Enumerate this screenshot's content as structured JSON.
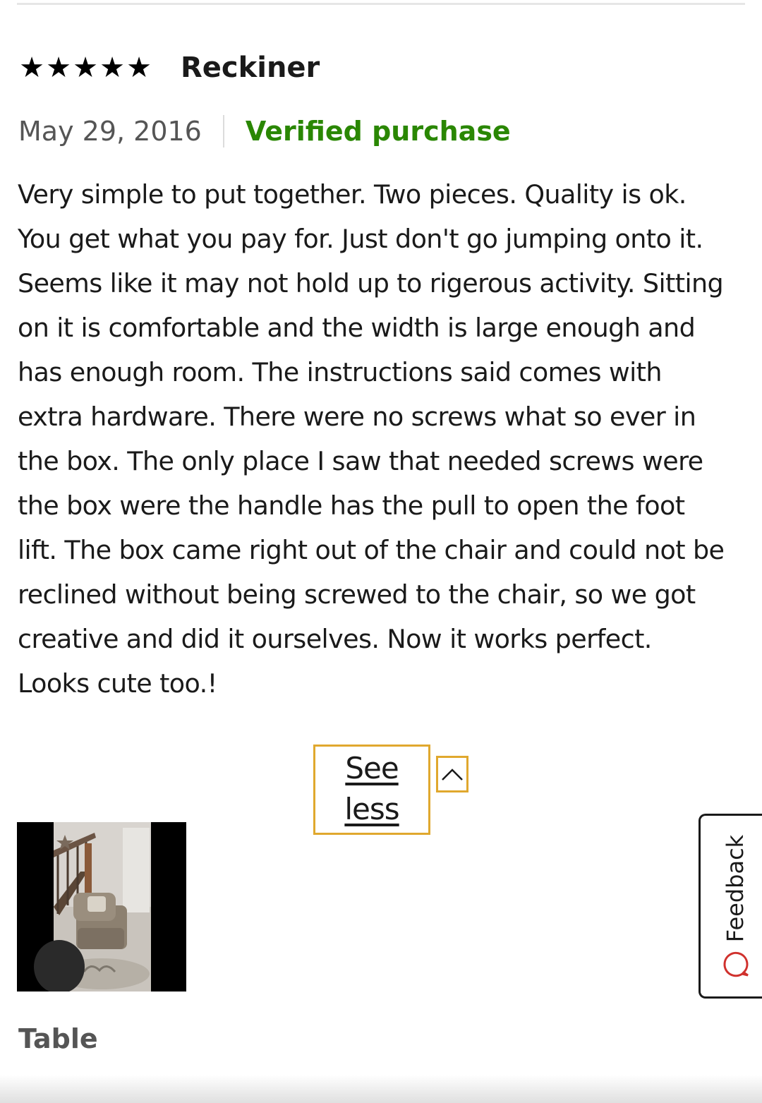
{
  "review": {
    "rating": 5,
    "rating_max": 5,
    "stars": [
      "★",
      "★",
      "★",
      "★",
      "★"
    ],
    "title": "Reckiner",
    "date": "May 29, 2016",
    "verified_label": "Verified purchase",
    "body": "Very simple to put together. Two pieces. Quality is ok. You get what you pay for. Just don't go jumping onto it. Seems like it may not hold up to rigerous activity. Sitting on it is comfortable and the width is large enough and has enough room. The instructions said comes with extra hardware. There were no screws what so ever in the box. The only place I saw that needed screws were the box were the handle has the pull to open the foot lift. The box came right out of the chair and could not be reclined without being screwed to the chair, so we got creative and did it ourselves. Now it works perfect. Looks cute too.!",
    "toggle_label": "See less",
    "photo_caption": "Table"
  },
  "feedback": {
    "label": "Feedback"
  },
  "colors": {
    "verified": "#2a8703",
    "focus_outline": "#e0a82e",
    "meta_text": "#555555"
  },
  "icons": {
    "toggle": "chevron-up-icon",
    "feedback": "speech-bubble-icon"
  }
}
